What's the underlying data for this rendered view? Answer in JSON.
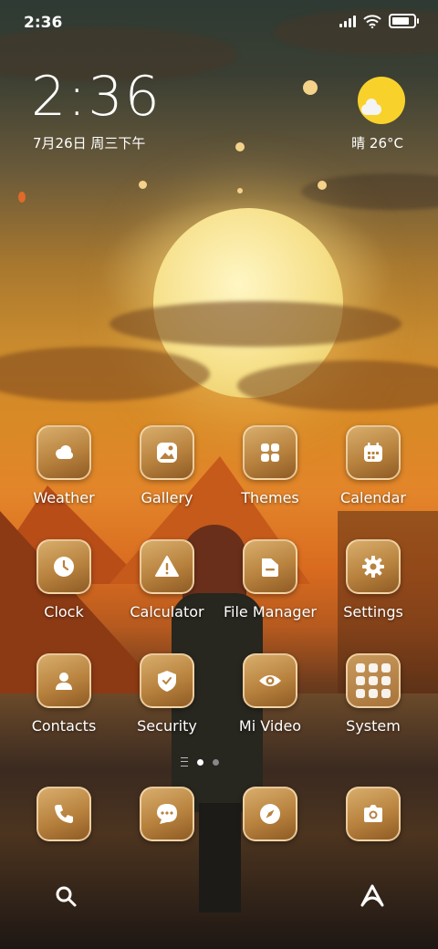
{
  "status_bar": {
    "time": "2:36"
  },
  "clock_widget": {
    "time": "2:36",
    "date": "7月26日 周三下午"
  },
  "weather_widget": {
    "text": "晴 26°C",
    "icon": "sun-cloud-icon"
  },
  "apps": [
    {
      "label": "Weather",
      "icon": "weather-icon"
    },
    {
      "label": "Gallery",
      "icon": "gallery-icon"
    },
    {
      "label": "Themes",
      "icon": "themes-icon"
    },
    {
      "label": "Calendar",
      "icon": "calendar-icon"
    },
    {
      "label": "Clock",
      "icon": "clock-icon"
    },
    {
      "label": "Calculator",
      "icon": "calculator-icon"
    },
    {
      "label": "File Manager",
      "icon": "file-manager-icon"
    },
    {
      "label": "Settings",
      "icon": "gear-icon"
    },
    {
      "label": "Contacts",
      "icon": "contacts-icon"
    },
    {
      "label": "Security",
      "icon": "shield-icon"
    },
    {
      "label": "Mi Video",
      "icon": "eye-icon"
    },
    {
      "label": "System",
      "icon": "folder-icon"
    }
  ],
  "dock": [
    {
      "icon": "phone-icon"
    },
    {
      "icon": "message-icon"
    },
    {
      "icon": "compass-icon"
    },
    {
      "icon": "camera-icon"
    }
  ],
  "bottom_bar": {
    "left_icon": "search-icon",
    "right_icon": "app-vault-icon"
  },
  "colors": {
    "icon_gold": "#c08a45",
    "weather_sun": "#f8d22b"
  }
}
